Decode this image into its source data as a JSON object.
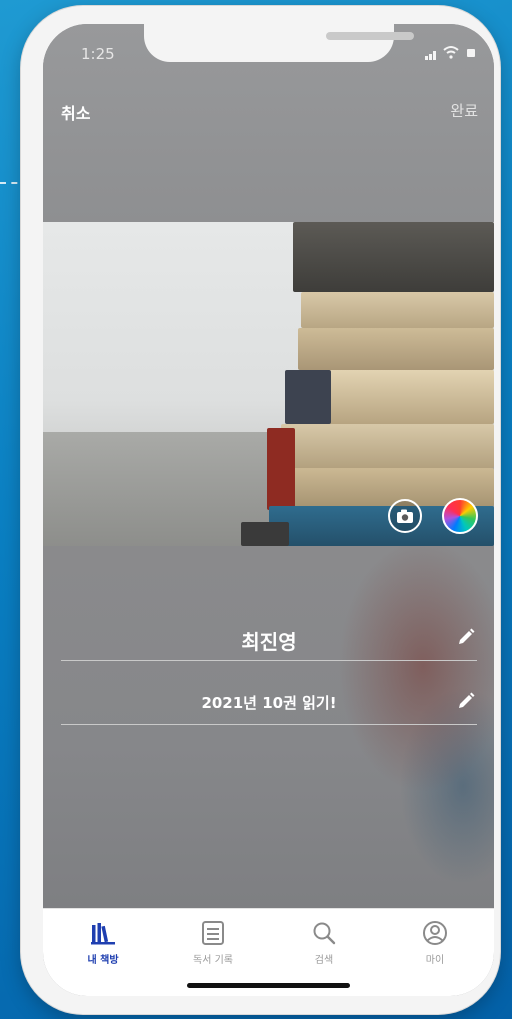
{
  "status_bar": {
    "time": "1:25"
  },
  "header": {
    "cancel_label": "취소",
    "done_label": "완료"
  },
  "cover": {
    "camera_icon": "camera-icon",
    "color_icon": "color-wheel-icon"
  },
  "profile": {
    "name": "최진영",
    "goal": "2021년 10권 읽기!"
  },
  "tabbar": {
    "tabs": [
      {
        "label": "내 책방",
        "icon": "bookshelf-icon",
        "active": true
      },
      {
        "label": "독서 기록",
        "icon": "notes-icon",
        "active": false
      },
      {
        "label": "검색",
        "icon": "search-icon",
        "active": false
      },
      {
        "label": "마이",
        "icon": "profile-icon",
        "active": false
      }
    ]
  },
  "colors": {
    "accent": "#1f3fb0",
    "background": "#0a7fc2"
  }
}
